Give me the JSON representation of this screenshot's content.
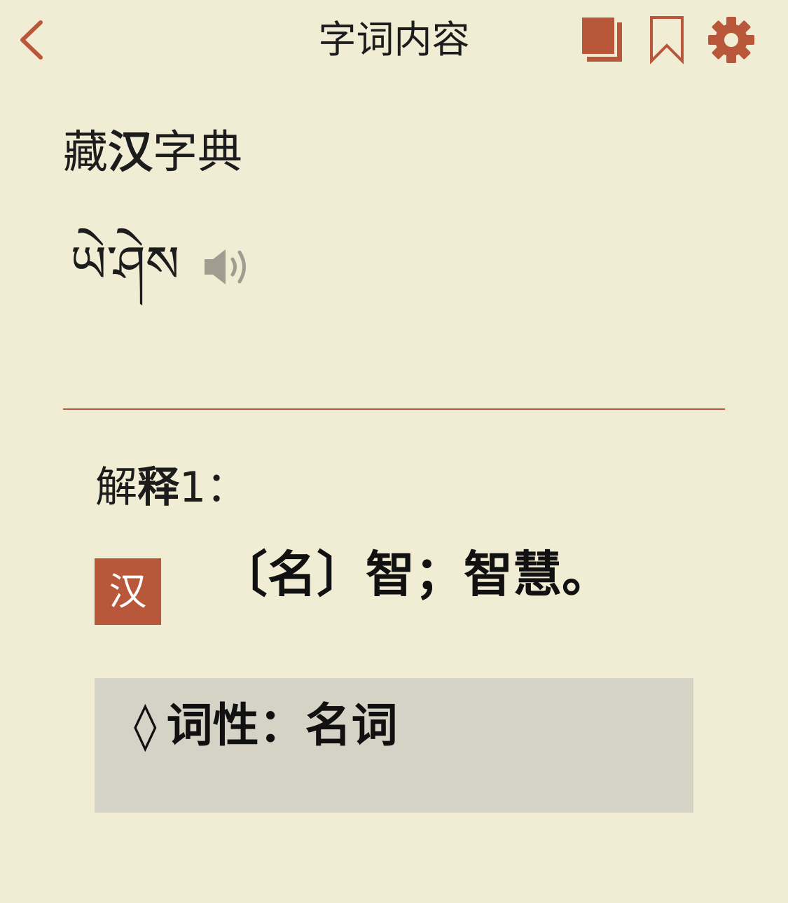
{
  "header": {
    "title": "字词内容",
    "back_icon": "chevron-left-icon",
    "copy_icon": "copy-icon",
    "bookmark_icon": "bookmark-icon",
    "settings_icon": "gear-icon"
  },
  "dictionary": {
    "name_part1": "藏",
    "name_part2_bold": "汉",
    "name_part3": "字典"
  },
  "entry": {
    "headword": "ཡེ་ཤེས",
    "audio_icon": "speaker-icon"
  },
  "definitions": [
    {
      "heading_part1": "解",
      "heading_part2_bold": "释",
      "heading_part3": "1：",
      "language_badge": "汉",
      "text": "〔名〕智；智慧。"
    }
  ],
  "part_of_speech": {
    "marker": "◊",
    "text": "词性：名词"
  },
  "colors": {
    "background": "#f1ecd4",
    "accent": "#b9573a",
    "pos_box": "#d5d3c6"
  }
}
